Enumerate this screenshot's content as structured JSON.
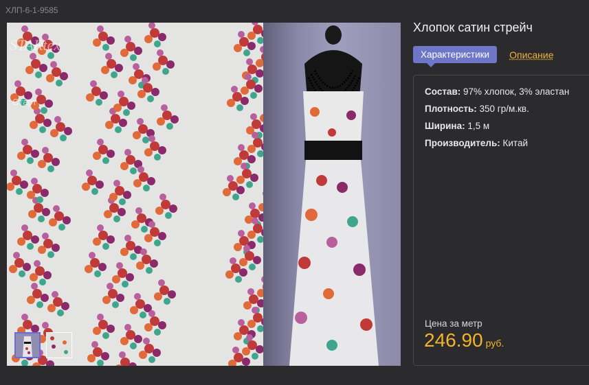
{
  "sku": "ХЛП-6-1-9585",
  "product": {
    "title": "Хлопок сатин стрейч"
  },
  "tabs": {
    "characteristics": "Характеристики",
    "description": "Описание"
  },
  "specs": [
    {
      "label": "Состав:",
      "value": " 97% хлопок, 3% эластан"
    },
    {
      "label": "Плотность:",
      "value": " 350 гр/м.кв."
    },
    {
      "label": "Ширина:",
      "value": " 1,5 м"
    },
    {
      "label": "Производитель:",
      "value": " Китай"
    }
  ],
  "price": {
    "label": "Цена за метр",
    "value": "246.90",
    "currency": "руб."
  },
  "gallery": {
    "watermark": "STARtex",
    "watermark_sub": "Старт"
  },
  "colors": {
    "accent_tab": "#6e76c8",
    "price": "#f3b528",
    "link": "#f0b238"
  }
}
